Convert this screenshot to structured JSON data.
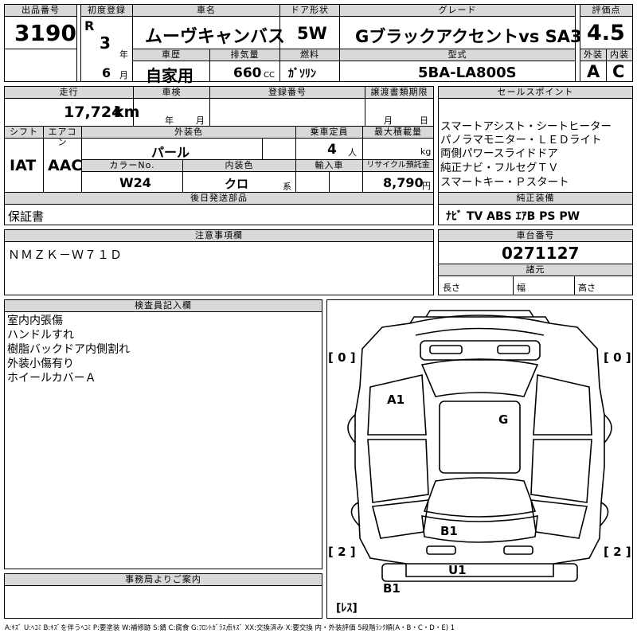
{
  "header_row": {
    "lot_label": "出品番号",
    "lot_value": "3190",
    "first_reg_label": "初度登録",
    "era": "R",
    "year_value": "3",
    "year_unit": "年",
    "month_value": "6",
    "month_unit": "月",
    "name_label": "車名",
    "name_value": "ムーヴキャンバス",
    "door_label": "ドア形状",
    "door_value": "5W",
    "grade_label": "グレード",
    "grade_value": "Gブラックアクセントvs SA3",
    "score_label": "評価点",
    "score_value": "4.5",
    "ext_label": "外装",
    "ext_value": "A",
    "int_label": "内装",
    "int_value": "C",
    "history_label": "車歴",
    "history_value": "自家用",
    "displacement_label": "排気量",
    "displacement_value": "660",
    "displacement_unit": "CC",
    "fuel_label": "燃料",
    "fuel_value": "ｶﾞｿﾘﾝ",
    "model_label": "型式",
    "model_value": "5BA-LA800S"
  },
  "row2": {
    "mileage_label": "走行",
    "mileage_value": "17,724",
    "mileage_unit": "km",
    "inspection_label": "車検",
    "inspection_year": "年",
    "inspection_month": "月",
    "reg_label": "登録番号",
    "transfer_label": "譲渡書類期限",
    "transfer_month": "月",
    "transfer_day": "日",
    "shift_label": "シフト",
    "shift_value": "IAT",
    "ac_label": "エアコン",
    "ac_value": "AAC",
    "exterior_color_label": "外装色",
    "exterior_color_value": "パール",
    "capacity_label": "乗車定員",
    "capacity_value": "4",
    "capacity_unit": "人",
    "max_load_label": "最大積載量",
    "max_load_unit": "kg",
    "color_no_label": "カラーNo.",
    "color_no_value": "W24",
    "interior_color_label": "内装色",
    "interior_color_value": "クロ",
    "interior_color_unit": "系",
    "import_label": "輸入車",
    "recycle_label": "リサイクル預託金",
    "recycle_value": "8,790",
    "recycle_unit": "円",
    "later_parts_label": "後日発送部品",
    "later_parts_value": "保証書"
  },
  "sales_points": {
    "label": "セールスポイント",
    "items": [
      "スマートアシスト・シートヒーター",
      "パノラマモニター・ＬＥＤライト",
      "両側パワースライドドア",
      "純正ナビ・フルセグＴＶ",
      "スマートキー・Ｐスタート"
    ],
    "equipment_label": "純正装備",
    "equipment_value": "ﾅﾋﾞ TV ABS ｴｱB PS PW"
  },
  "notes": {
    "label": "注意事項欄",
    "value": "ＮＭＺＫ－Ｗ７１Ｄ"
  },
  "chassis": {
    "label": "車台番号",
    "value": "0271127",
    "dims_label": "諸元",
    "length_label": "長さ",
    "width_label": "幅",
    "height_label": "高さ"
  },
  "inspector": {
    "label": "検査員記入欄",
    "lines": [
      "室内内張傷",
      "ハンドルすれ",
      "樹脂バックドア内側割れ",
      "外装小傷有り",
      "ホイールカバーＡ"
    ]
  },
  "office": {
    "label": "事務局よりご案内"
  },
  "diagram": {
    "tire_fl": "[ 0 ]",
    "tire_fr": "[ 0 ]",
    "tire_rl": "[ 2 ]",
    "tire_rr": "[ 2 ]",
    "spare": "[ﾚｽ]",
    "marks": {
      "a1": "A1",
      "g": "G",
      "b1_rear": "B1",
      "u1": "U1",
      "b1_bumper": "B1"
    }
  },
  "legend": "A:ｷｽﾞ U:ﾍｺﾐ B:ｷｽﾞを伴うﾍｺﾐ P:要塗装 W:補修跡 S:錆 C:腐食 G:ﾌﾛﾝﾄｶﾞﾗｽ点ｷｽﾞ XX:交換済み X:要交換 内・外装評価 5段階ﾗﾝｸ順(A・B・C・D・E) 1"
}
